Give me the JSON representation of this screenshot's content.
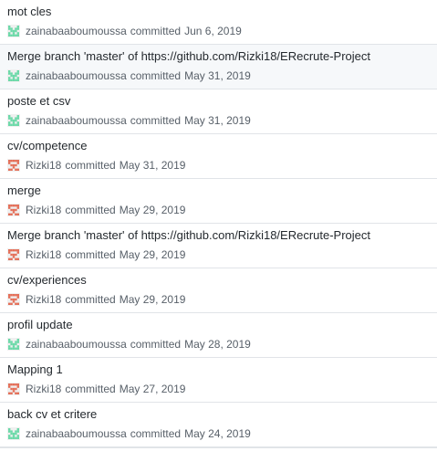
{
  "commits": [
    {
      "title": "mot cles",
      "author": "zainabaaboumoussa",
      "verb": "committed",
      "date": "Jun 6, 2019",
      "avatar": "green-identicon",
      "highlighted": false
    },
    {
      "title": "Merge branch 'master' of https://github.com/Rizki18/ERecrute-Project",
      "author": "zainabaaboumoussa",
      "verb": "committed",
      "date": "May 31, 2019",
      "avatar": "green-identicon",
      "highlighted": true
    },
    {
      "title": "poste et csv",
      "author": "zainabaaboumoussa",
      "verb": "committed",
      "date": "May 31, 2019",
      "avatar": "green-identicon",
      "highlighted": false
    },
    {
      "title": "cv/competence",
      "author": "Rizki18",
      "verb": "committed",
      "date": "May 31, 2019",
      "avatar": "red-identicon",
      "highlighted": false
    },
    {
      "title": "merge",
      "author": "Rizki18",
      "verb": "committed",
      "date": "May 29, 2019",
      "avatar": "red-identicon",
      "highlighted": false
    },
    {
      "title": "Merge branch 'master' of https://github.com/Rizki18/ERecrute-Project",
      "author": "Rizki18",
      "verb": "committed",
      "date": "May 29, 2019",
      "avatar": "red-identicon",
      "highlighted": false
    },
    {
      "title": "cv/experiences",
      "author": "Rizki18",
      "verb": "committed",
      "date": "May 29, 2019",
      "avatar": "red-identicon",
      "highlighted": false
    },
    {
      "title": "profil update",
      "author": "zainabaaboumoussa",
      "verb": "committed",
      "date": "May 28, 2019",
      "avatar": "green-identicon",
      "highlighted": false
    },
    {
      "title": "Mapping 1",
      "author": "Rizki18",
      "verb": "committed",
      "date": "May 27, 2019",
      "avatar": "red-identicon",
      "highlighted": false
    },
    {
      "title": "back cv et critere",
      "author": "zainabaaboumoussa",
      "verb": "committed",
      "date": "May 24, 2019",
      "avatar": "green-identicon",
      "highlighted": false
    }
  ],
  "colors": {
    "green_identicon": "#6bd9a8",
    "red_identicon": "#e46f58",
    "row_highlight": "#f6f8fa",
    "border": "#e1e4e8",
    "title_text": "#24292e",
    "meta_text": "#586069"
  }
}
